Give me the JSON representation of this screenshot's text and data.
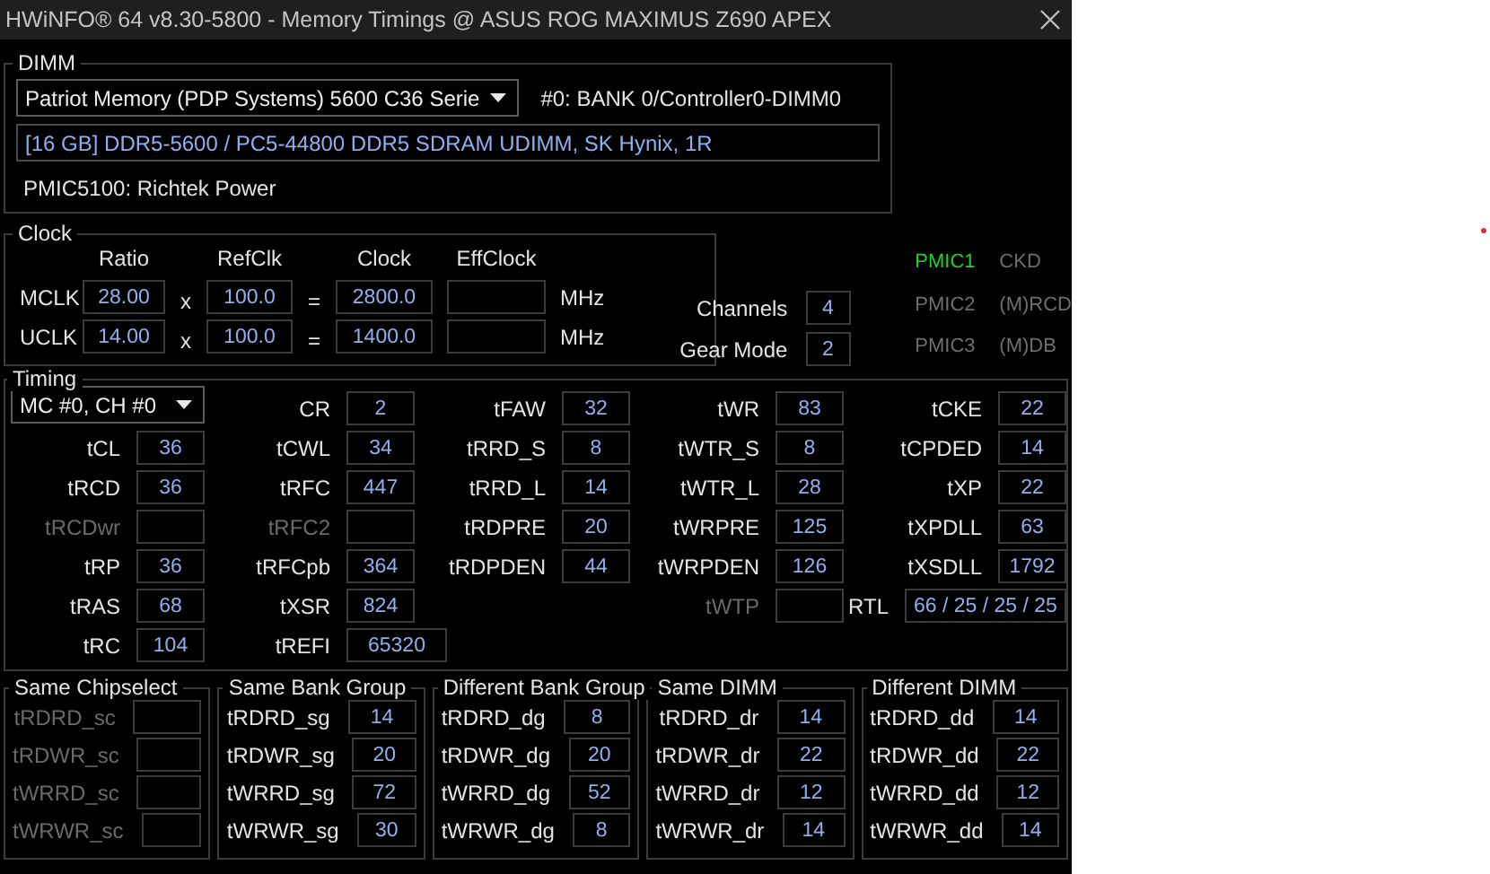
{
  "window": {
    "title": "HWiNFO® 64 v8.30-5800 - Memory Timings @ ASUS ROG MAXIMUS Z690 APEX"
  },
  "dimm": {
    "legend": "DIMM",
    "module": "Patriot Memory (PDP Systems) 5600 C36 Serie",
    "slot": "#0: BANK 0/Controller0-DIMM0",
    "info": "[16 GB] DDR5-5600 / PC5-44800 DDR5 SDRAM UDIMM, SK Hynix, 1R",
    "pmic": "PMIC5100: Richtek Power"
  },
  "clock": {
    "legend": "Clock",
    "headers": [
      "Ratio",
      "RefClk",
      "Clock",
      "EffClock"
    ],
    "rows": [
      {
        "name": "MCLK",
        "ratio": "28.00",
        "times": "x",
        "refclk": "100.0",
        "equals": "=",
        "clock": "2800.0",
        "unit": "MHz"
      },
      {
        "name": "UCLK",
        "ratio": "14.00",
        "times": "x",
        "refclk": "100.0",
        "equals": "=",
        "clock": "1400.0",
        "unit": "MHz"
      }
    ]
  },
  "config": [
    {
      "label": "Channels",
      "value": "4"
    },
    {
      "label": "Gear Mode",
      "value": "2"
    }
  ],
  "pmics": [
    {
      "name": "PMIC1",
      "target": "CKD",
      "active": true
    },
    {
      "name": "PMIC2",
      "target": "(M)RCD",
      "active": false
    },
    {
      "name": "PMIC3",
      "target": "(M)DB",
      "active": false
    }
  ],
  "timing": {
    "legend": "Timing",
    "columns": [
      {
        "items": [
          {
            "kind": "selector",
            "value": "MC #0, CH #0"
          },
          {
            "kind": "field",
            "label": "tCL",
            "value": "36",
            "disabled": false
          },
          {
            "kind": "field",
            "label": "tRCD",
            "value": "36",
            "disabled": false
          },
          {
            "kind": "field",
            "label": "tRCDwr",
            "disabled": true
          },
          {
            "kind": "field",
            "label": "tRP",
            "value": "36",
            "disabled": false
          },
          {
            "kind": "field",
            "label": "tRAS",
            "value": "68",
            "disabled": false
          },
          {
            "kind": "field",
            "label": "tRC",
            "value": "104",
            "disabled": false
          }
        ]
      },
      {
        "items": [
          {
            "kind": "field",
            "label": "CR",
            "value": "2",
            "disabled": false
          },
          {
            "kind": "field",
            "label": "tCWL",
            "value": "34",
            "disabled": false
          },
          {
            "kind": "field",
            "label": "tRFC",
            "value": "447",
            "disabled": false
          },
          {
            "kind": "field",
            "label": "tRFC2",
            "disabled": true
          },
          {
            "kind": "field",
            "label": "tRFCpb",
            "value": "364",
            "disabled": false
          },
          {
            "kind": "field",
            "label": "tXSR",
            "value": "824",
            "disabled": false
          },
          {
            "kind": "wide",
            "label": "tREFI",
            "value": "65320",
            "disabled": false
          }
        ]
      },
      {
        "items": [
          {
            "kind": "field",
            "label": "tFAW",
            "value": "32",
            "disabled": false
          },
          {
            "kind": "field",
            "label": "tRRD_S",
            "value": "8",
            "disabled": false
          },
          {
            "kind": "field",
            "label": "tRRD_L",
            "value": "14",
            "disabled": false
          },
          {
            "kind": "field",
            "label": "tRDPRE",
            "value": "20",
            "disabled": false
          },
          {
            "kind": "field",
            "label": "tRDPDEN",
            "value": "44",
            "disabled": false
          }
        ]
      },
      {
        "items": [
          {
            "kind": "field",
            "label": "tWR",
            "value": "83",
            "disabled": false
          },
          {
            "kind": "field",
            "label": "tWTR_S",
            "value": "8",
            "disabled": false
          },
          {
            "kind": "field",
            "label": "tWTR_L",
            "value": "28",
            "disabled": false
          },
          {
            "kind": "field",
            "label": "tWRPRE",
            "value": "125",
            "disabled": false
          },
          {
            "kind": "field",
            "label": "tWRPDEN",
            "value": "126",
            "disabled": false
          },
          {
            "kind": "field",
            "label": "tWTP",
            "disabled": true
          }
        ]
      },
      {
        "items": [
          {
            "kind": "field",
            "label": "tCKE",
            "value": "22",
            "disabled": false
          },
          {
            "kind": "field",
            "label": "tCPDED",
            "value": "14",
            "disabled": false
          },
          {
            "kind": "field",
            "label": "tXP",
            "value": "22",
            "disabled": false
          },
          {
            "kind": "field",
            "label": "tXPDLL",
            "value": "63",
            "disabled": false
          },
          {
            "kind": "field",
            "label": "tXSDLL",
            "value": "1792",
            "disabled": false
          },
          {
            "kind": "long",
            "label": "RTL",
            "value": "66 / 25 / 25 / 25",
            "disabled": false
          }
        ]
      }
    ]
  },
  "groups": [
    {
      "legend": "Same Chipselect",
      "rows": [
        {
          "label": "tRDRD_sc",
          "disabled": true
        },
        {
          "label": "tRDWR_sc",
          "disabled": true
        },
        {
          "label": "tWRRD_sc",
          "disabled": true
        },
        {
          "label": "tWRWR_sc",
          "disabled": true
        }
      ]
    },
    {
      "legend": "Same Bank Group",
      "rows": [
        {
          "label": "tRDRD_sg",
          "value": "14",
          "disabled": false
        },
        {
          "label": "tRDWR_sg",
          "value": "20",
          "disabled": false
        },
        {
          "label": "tWRRD_sg",
          "value": "72",
          "disabled": false
        },
        {
          "label": "tWRWR_sg",
          "value": "30",
          "disabled": false
        }
      ]
    },
    {
      "legend": "Different Bank Group",
      "rows": [
        {
          "label": "tRDRD_dg",
          "value": "8",
          "disabled": false
        },
        {
          "label": "tRDWR_dg",
          "value": "20",
          "disabled": false
        },
        {
          "label": "tWRRD_dg",
          "value": "52",
          "disabled": false
        },
        {
          "label": "tWRWR_dg",
          "value": "8",
          "disabled": false
        }
      ]
    },
    {
      "legend": "Same DIMM",
      "rows": [
        {
          "label": "tRDRD_dr",
          "value": "14",
          "disabled": false
        },
        {
          "label": "tRDWR_dr",
          "value": "22",
          "disabled": false
        },
        {
          "label": "tWRRD_dr",
          "value": "12",
          "disabled": false
        },
        {
          "label": "tWRWR_dr",
          "value": "14",
          "disabled": false
        }
      ]
    },
    {
      "legend": "Different DIMM",
      "rows": [
        {
          "label": "tRDRD_dd",
          "value": "14",
          "disabled": false
        },
        {
          "label": "tRDWR_dd",
          "value": "22",
          "disabled": false
        },
        {
          "label": "tWRRD_dd",
          "value": "12",
          "disabled": false
        },
        {
          "label": "tWRWR_dd",
          "value": "14",
          "disabled": false
        }
      ]
    }
  ]
}
